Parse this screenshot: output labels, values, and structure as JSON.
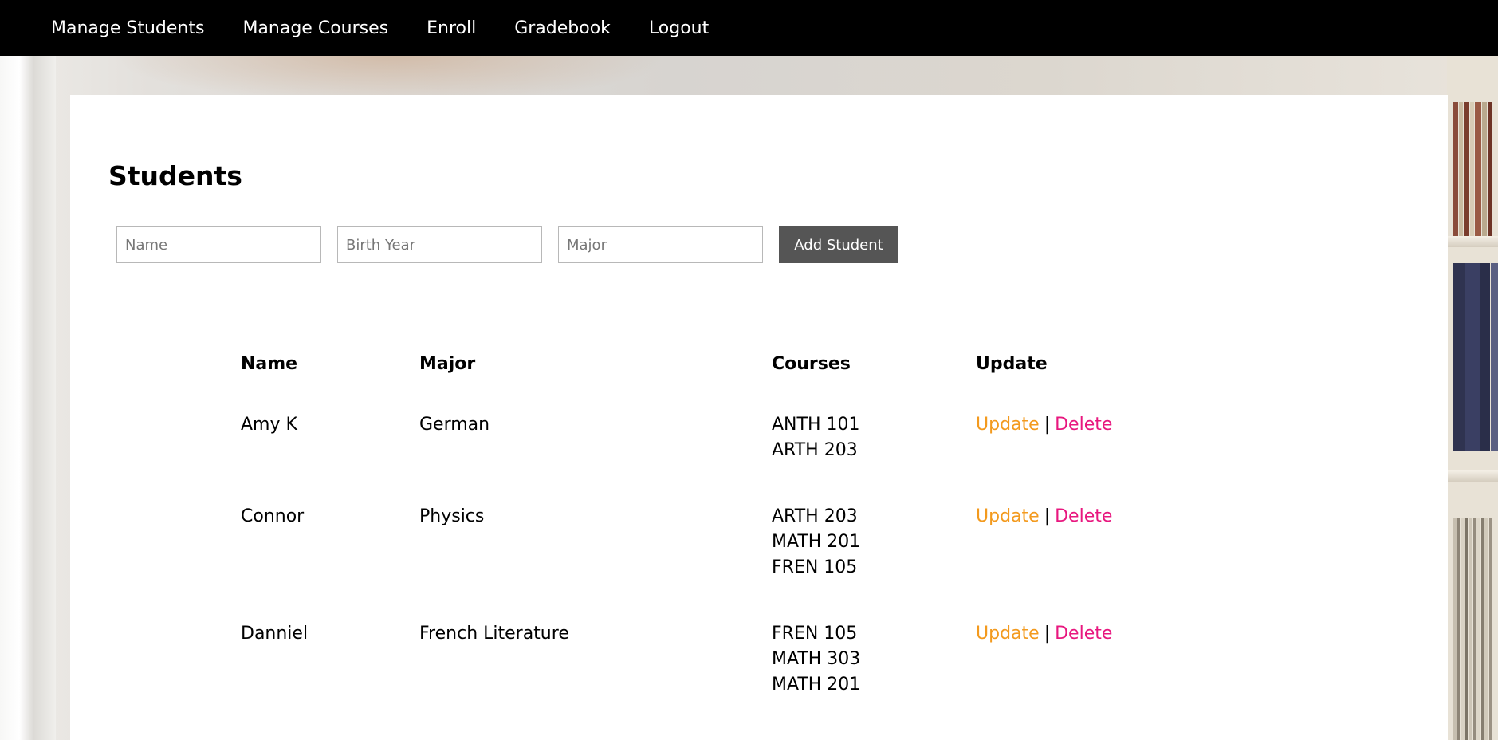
{
  "nav": {
    "items": [
      {
        "label": "Manage Students"
      },
      {
        "label": "Manage Courses"
      },
      {
        "label": "Enroll"
      },
      {
        "label": "Gradebook"
      },
      {
        "label": "Logout"
      }
    ]
  },
  "page": {
    "title": "Students"
  },
  "form": {
    "name_placeholder": "Name",
    "birth_year_placeholder": "Birth Year",
    "major_placeholder": "Major",
    "name_value": "",
    "birth_year_value": "",
    "major_value": "",
    "add_button_label": "Add Student"
  },
  "table": {
    "headers": {
      "name": "Name",
      "major": "Major",
      "courses": "Courses",
      "update": "Update"
    },
    "update_link_label": "Update",
    "separator": "|",
    "delete_link_label": "Delete",
    "rows": [
      {
        "name": "Amy K",
        "major": "German",
        "courses": [
          "ANTH 101",
          "ARTH 203"
        ]
      },
      {
        "name": "Connor",
        "major": "Physics",
        "courses": [
          "ARTH 203",
          "MATH 201",
          "FREN 105"
        ]
      },
      {
        "name": "Danniel",
        "major": "French Literature",
        "courses": [
          "FREN 105",
          "MATH 303",
          "MATH 201"
        ]
      }
    ]
  },
  "colors": {
    "navbar_bg": "#000000",
    "button_bg": "#555555",
    "update_link": "#f39a1e",
    "delete_link": "#e8177f"
  }
}
